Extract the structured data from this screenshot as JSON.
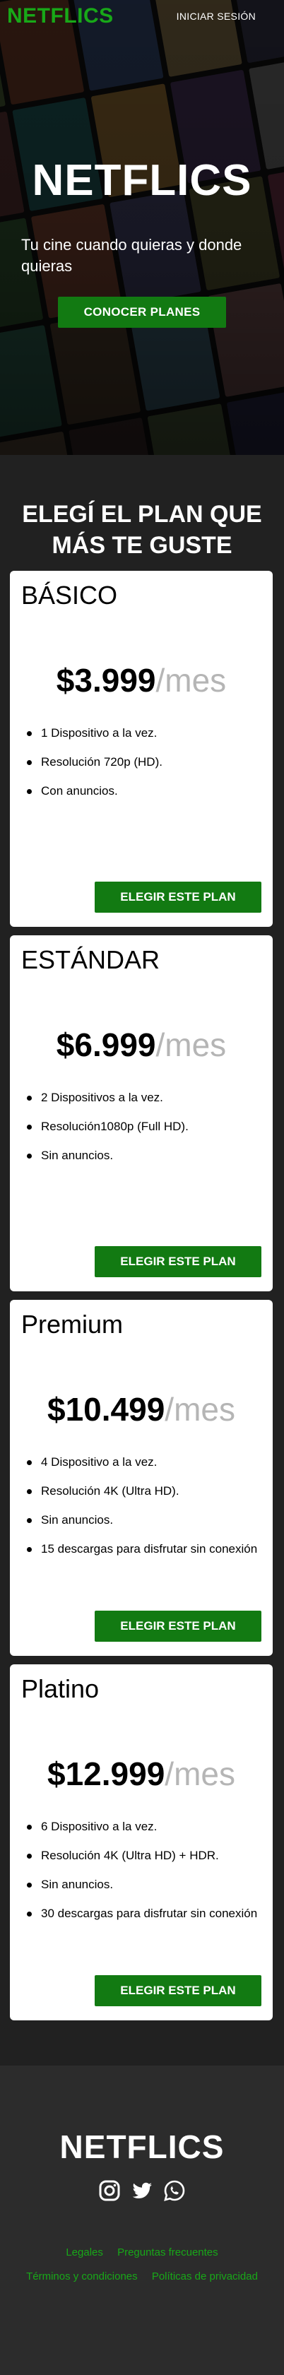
{
  "header": {
    "logo": "NETFLICS",
    "login_label": "INICIAR SESIÓN"
  },
  "hero": {
    "title": "NETFLICS",
    "subtitle": "Tu cine cuando quieras y donde quieras",
    "cta_label": "CONOCER PLANES"
  },
  "plans": {
    "title": "ELEGÍ EL PLAN QUE MÁS TE GUSTE",
    "items": [
      {
        "name": "BÁSICO",
        "price": "$3.999",
        "period": "/mes",
        "features": [
          "1 Dispositivo a la vez.",
          "Resolución 720p (HD).",
          "Con anuncios."
        ],
        "button": "ELEGIR ESTE PLAN"
      },
      {
        "name": "ESTÁNDAR",
        "price": "$6.999",
        "period": "/mes",
        "features": [
          "2 Dispositivos a la vez.",
          "Resolución1080p (Full HD).",
          "Sin anuncios."
        ],
        "button": "ELEGIR ESTE PLAN"
      },
      {
        "name": "Premium",
        "price": "$10.499",
        "period": "/mes",
        "features": [
          "4 Dispositivo a la vez.",
          "Resolución 4K (Ultra HD).",
          "Sin anuncios.",
          "15 descargas para disfrutar sin conexión"
        ],
        "button": "ELEGIR ESTE PLAN"
      },
      {
        "name": "Platino",
        "price": "$12.999",
        "period": "/mes",
        "features": [
          "6 Dispositivo a la vez.",
          "Resolución 4K (Ultra HD) + HDR.",
          "Sin anuncios.",
          "30 descargas para disfrutar sin conexión"
        ],
        "button": "ELEGIR ESTE PLAN"
      }
    ]
  },
  "footer": {
    "logo": "NETFLICS",
    "social_icons": [
      "instagram-icon",
      "twitter-icon",
      "whatsapp-icon"
    ],
    "links_row1": [
      "Legales",
      "Preguntas frecuentes"
    ],
    "links_row2": [
      "Términos y condiciones",
      "Políticas de privacidad"
    ]
  },
  "colors": {
    "brand_green": "#18a818",
    "button_green": "#127a12",
    "background": "#212121",
    "footer_bg": "#2c2c2c"
  }
}
